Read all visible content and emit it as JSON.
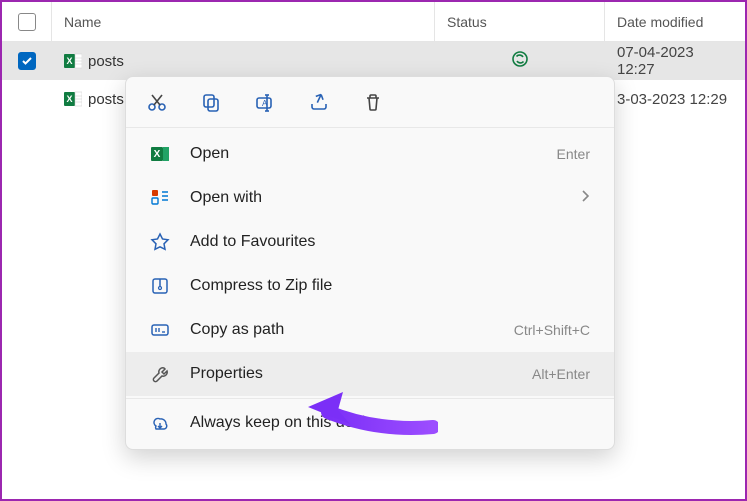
{
  "header": {
    "name": "Name",
    "status": "Status",
    "date": "Date modified"
  },
  "files": [
    {
      "name": "posts",
      "selected": true,
      "date": "07-04-2023 12:27"
    },
    {
      "name": "posts",
      "selected": false,
      "date": "3-03-2023 12:29"
    }
  ],
  "context_menu": {
    "items": [
      {
        "label": "Open",
        "shortcut": "Enter"
      },
      {
        "label": "Open with",
        "chevron": true
      },
      {
        "label": "Add to Favourites"
      },
      {
        "label": "Compress to Zip file"
      },
      {
        "label": "Copy as path",
        "shortcut": "Ctrl+Shift+C"
      },
      {
        "label": "Properties",
        "shortcut": "Alt+Enter"
      },
      {
        "label": "Always keep on this device"
      }
    ]
  }
}
